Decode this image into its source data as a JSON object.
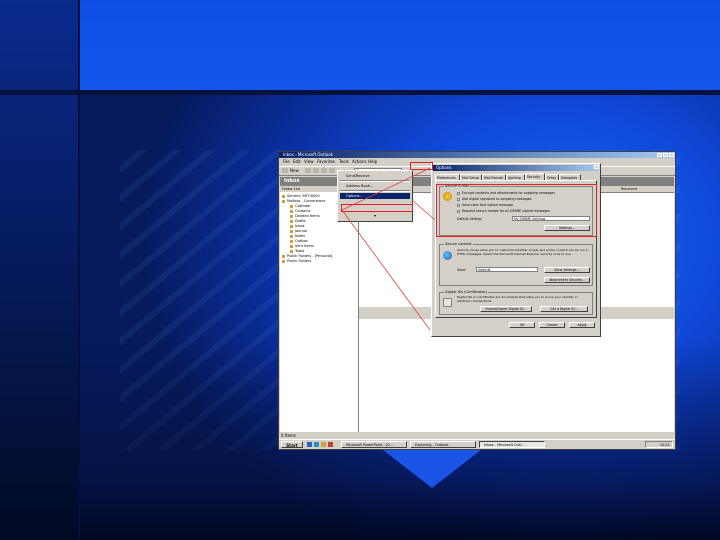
{
  "window": {
    "title": "Inbox - Microsoft Outlook",
    "menus": [
      "File",
      "Edit",
      "View",
      "Favorites",
      "Tools",
      "Actions",
      "Help"
    ],
    "toolbar": {
      "new_label": "New",
      "address_box": "Type a contact to find"
    },
    "folder_title": "Inbox",
    "folder_list_header": "Folder List",
    "folders": [
      "Servers' INFO0000",
      "Mailbox - Cornerstone",
      "Calendar",
      "Contacts",
      "Deleted Items",
      "Drafts",
      "Inbox",
      "Journal",
      "Notes",
      "Outbox",
      "Sent Items",
      "Tasks",
      "Public Folders - [Personal]",
      "Public Folders"
    ],
    "list_header": [
      "Subject",
      "Received"
    ],
    "status_text": "0 Items"
  },
  "tools_menu": {
    "items": [
      "Send/Receive",
      "Address Book...",
      "Options..."
    ],
    "highlighted_index": 2
  },
  "options_dialog": {
    "title": "Options",
    "tabs": [
      "Preferences",
      "Mail Setup",
      "Mail Format",
      "Spelling",
      "Security",
      "Other",
      "Delegates"
    ],
    "active_tab": "Security",
    "secure_email": {
      "title": "Secure e-mail",
      "options": [
        "Encrypt contents and attachments for outgoing messages",
        "Add digital signature to outgoing messages",
        "Send clear text signed message",
        "Request secure receipt for all S/MIME signed messages"
      ],
      "default_setting_label": "Default Setting:",
      "default_setting_value": "My S/MIME Settings",
      "settings_button": "Settings..."
    },
    "secure_content": {
      "title": "Secure content",
      "description": "Security zones allow you to customize whether scripts and active content can be run in HTML messages. Select the Microsoft Internet Explorer security zone to use.",
      "zone_label": "Zone:",
      "zone_value": "Internet",
      "zone_settings_button": "Zone Settings...",
      "attachment_button": "Attachment Security..."
    },
    "digital_ids": {
      "title": "Digital IDs (Certificates)",
      "description": "Digital IDs or Certificates are documents that allow you to prove your identity in electronic transactions.",
      "import_button": "Import/Export Digital ID...",
      "get_button": "Get a Digital ID..."
    },
    "buttons": [
      "OK",
      "Cancel",
      "Apply"
    ]
  },
  "taskbar": {
    "start_label": "Start",
    "tasks": [
      "Microsoft PowerPoint - [O...",
      "Exploring - Outlook",
      "Inbox - Microsoft Outl..."
    ],
    "active_task_index": 2,
    "clock": "10:21"
  }
}
